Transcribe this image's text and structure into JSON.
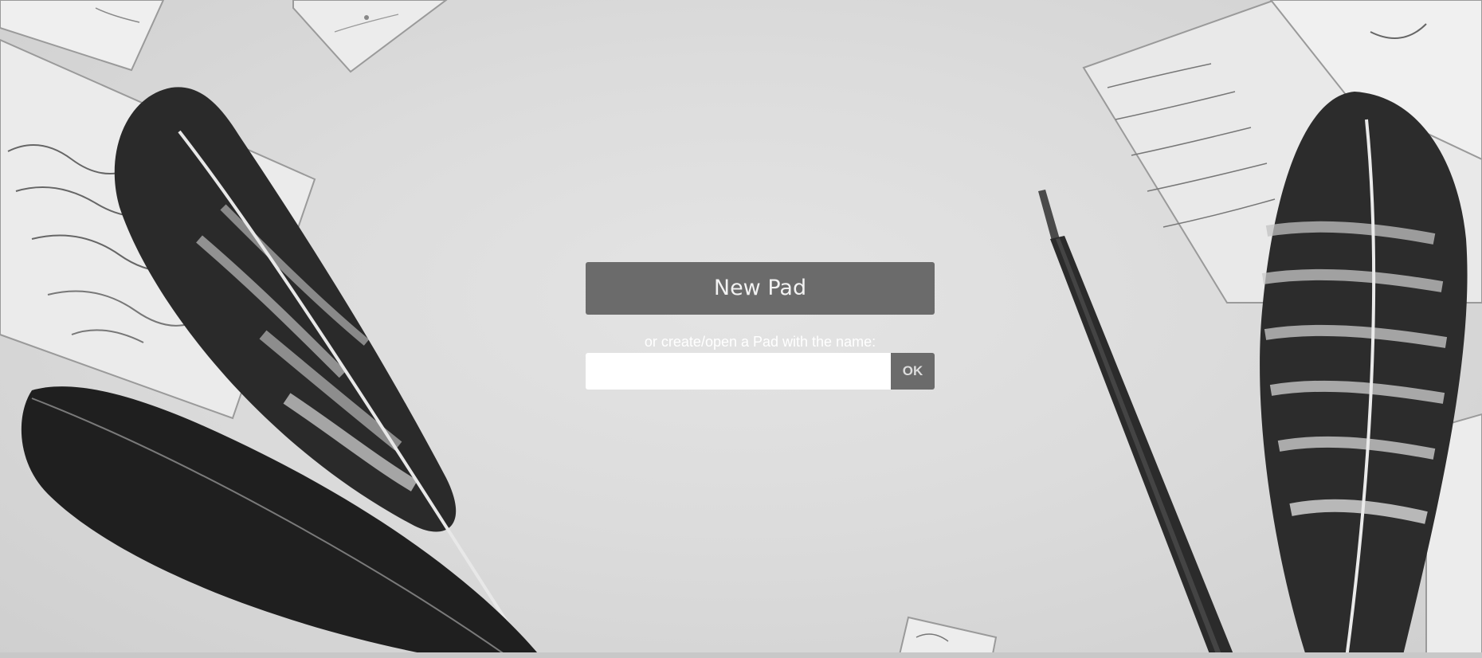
{
  "new_pad_button": {
    "label": "New Pad"
  },
  "open_pad": {
    "prompt": "or create/open a Pad with the name:",
    "input_value": "",
    "ok_label": "OK"
  },
  "colors": {
    "button_bg": "#6b6b6b",
    "background": "#dcdcdc"
  },
  "background_image": "grayscale desk with feathers, postcards and a dip pen"
}
